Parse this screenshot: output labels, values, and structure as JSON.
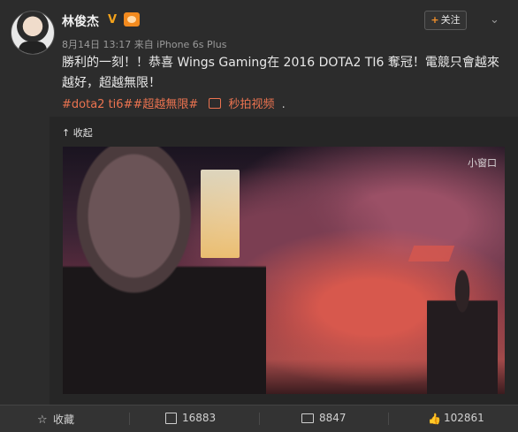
{
  "user": {
    "name": "林俊杰",
    "verified_mark": "V",
    "meta": "8月14日 13:17 来自 iPhone 6s Plus"
  },
  "header": {
    "follow_plus": "+",
    "follow_label": "关注",
    "more_icon": "chevron-down-icon"
  },
  "post": {
    "text": "勝利的一刻！！恭喜 Wings Gaming在 2016 DOTA2 TI6 奪冠！電競只會越來越好，超越無限！",
    "tags": "#dota2 ti6##超越無限#",
    "video_link": "秒拍视频",
    "dot": ".",
    "collapse": "收起"
  },
  "video": {
    "brand": "秒拍",
    "window_label": "小窗口"
  },
  "actions": {
    "favorite": "收藏",
    "repost_count": "16883",
    "comment_count": "8847",
    "like_count": "102861"
  },
  "colors": {
    "background": "#2c2c2c",
    "link": "#eb7350",
    "badge": "#f3a21b"
  }
}
